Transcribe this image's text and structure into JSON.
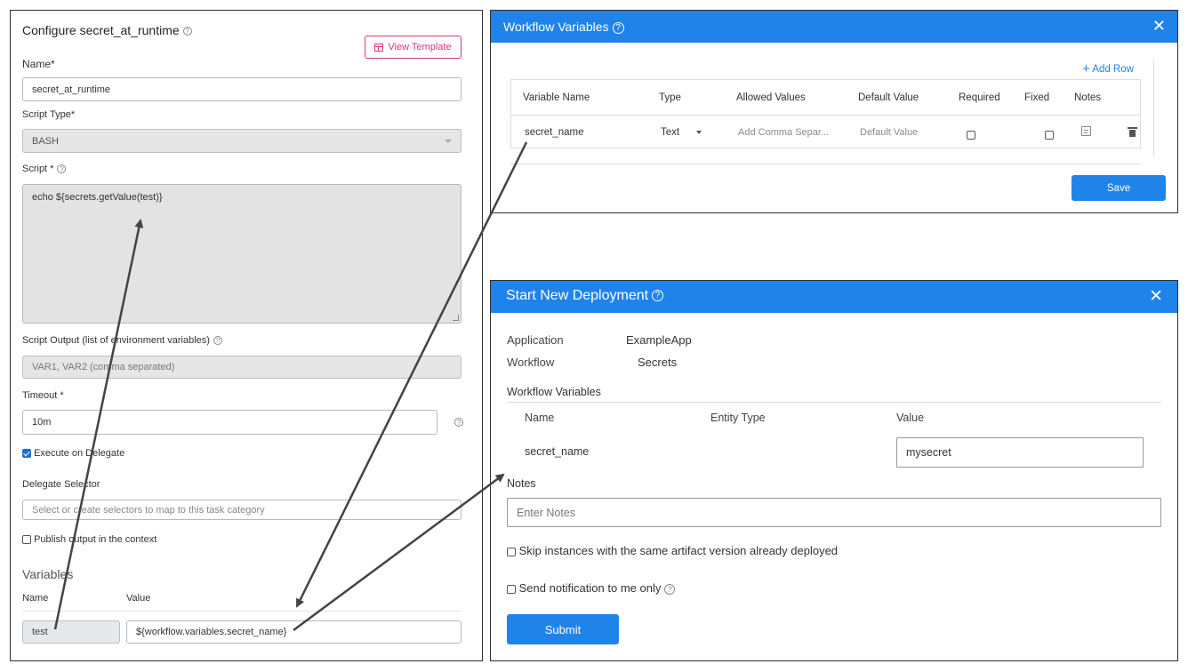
{
  "configure": {
    "title": "Configure secret_at_runtime",
    "view_template": "View Template",
    "name_label": "Name*",
    "name_value": "secret_at_runtime",
    "script_type_label": "Script Type*",
    "script_type_value": "BASH",
    "script_label": "Script *",
    "script_value": "echo ${secrets.getValue(test)}",
    "script_output_label": "Script Output (list of environment variables)",
    "script_output_placeholder": "VAR1, VAR2 (comma separated)",
    "timeout_label": "Timeout *",
    "timeout_value": "10m",
    "execute_on_delegate": "Execute on Delegate",
    "delegate_selector_label": "Delegate Selector",
    "delegate_selector_placeholder": "Select or create selectors to map to this task category",
    "publish_output": "Publish output in the context",
    "variables_heading": "Variables",
    "var_name_header": "Name",
    "var_value_header": "Value",
    "var_name": "test",
    "var_value": "${workflow.variables.secret_name}"
  },
  "workflow_variables": {
    "title": "Workflow Variables",
    "add_row": "Add Row",
    "headers": [
      "Variable Name",
      "Type",
      "Allowed Values",
      "Default Value",
      "Required",
      "Fixed",
      "Notes"
    ],
    "row": {
      "name": "secret_name",
      "type": "Text",
      "allowed_placeholder": "Add Comma Separ...",
      "default_placeholder": "Default Value"
    },
    "save": "Save"
  },
  "deployment": {
    "title": "Start New Deployment",
    "application_label": "Application",
    "application_value": "ExampleApp",
    "workflow_label": "Workflow",
    "workflow_value": "Secrets",
    "workflow_variables_heading": "Workflow Variables",
    "col_name": "Name",
    "col_entity_type": "Entity Type",
    "col_value": "Value",
    "var_name": "secret_name",
    "var_value": "mysecret",
    "notes_label": "Notes",
    "notes_placeholder": "Enter Notes",
    "skip_instances": "Skip instances with the same artifact version already deployed",
    "send_notification": "Send notification to me only",
    "submit": "Submit"
  },
  "colors": {
    "accent_blue": "#1f83ea",
    "view_template_pink": "#d6338a",
    "arrow": "#444444"
  }
}
